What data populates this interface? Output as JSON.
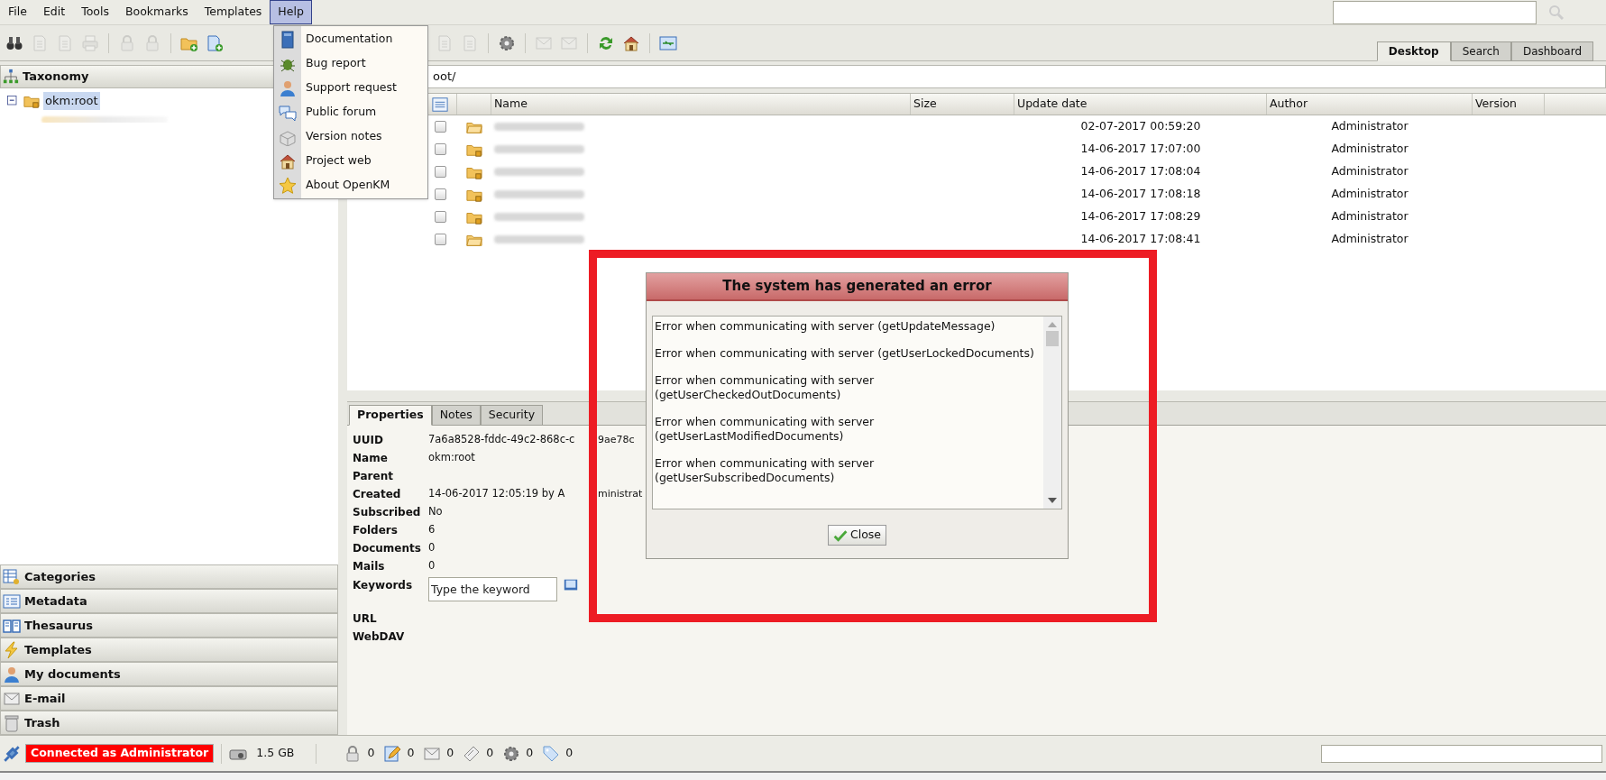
{
  "menu_bar": {
    "items": [
      {
        "label": "File",
        "selected": false
      },
      {
        "label": "Edit",
        "selected": false
      },
      {
        "label": "Tools",
        "selected": false
      },
      {
        "label": "Bookmarks",
        "selected": false
      },
      {
        "label": "Templates",
        "selected": false
      },
      {
        "label": "Help",
        "selected": true
      }
    ]
  },
  "toolbar": {
    "left": [
      {
        "kind": "binoculars",
        "disabled": false
      },
      {
        "kind": "document",
        "disabled": true
      },
      {
        "kind": "document",
        "disabled": true
      },
      {
        "kind": "printer",
        "disabled": true
      },
      {
        "kind": "separator"
      },
      {
        "kind": "lock",
        "disabled": true
      },
      {
        "kind": "lock",
        "disabled": true
      },
      {
        "kind": "separator"
      },
      {
        "kind": "folder_add",
        "disabled": false
      },
      {
        "kind": "document_add",
        "disabled": false
      }
    ],
    "right": [
      {
        "kind": "document",
        "disabled": true
      },
      {
        "kind": "document",
        "disabled": true
      },
      {
        "kind": "separator"
      },
      {
        "kind": "gear",
        "disabled": false
      },
      {
        "kind": "separator"
      },
      {
        "kind": "mail",
        "disabled": true
      },
      {
        "kind": "mail",
        "disabled": true
      },
      {
        "kind": "separator"
      },
      {
        "kind": "refresh",
        "disabled": false
      },
      {
        "kind": "home",
        "disabled": false
      },
      {
        "kind": "separator"
      },
      {
        "kind": "window",
        "disabled": false
      }
    ]
  },
  "tabs": [
    {
      "label": "Desktop",
      "selected": true
    },
    {
      "label": "Search",
      "selected": false
    },
    {
      "label": "Dashboard",
      "selected": false
    }
  ],
  "help_menu": [
    {
      "kind": "book",
      "label": "Documentation"
    },
    {
      "kind": "bug",
      "label": "Bug report"
    },
    {
      "kind": "person",
      "label": "Support request"
    },
    {
      "kind": "chat",
      "label": "Public forum"
    },
    {
      "kind": "blocks",
      "label": "Version notes"
    },
    {
      "kind": "home",
      "label": "Project web"
    },
    {
      "kind": "star",
      "label": "About OpenKM"
    }
  ],
  "navigator": {
    "header": "Taxonomy",
    "tree": {
      "label": "okm:root",
      "expanded": true,
      "selected": true,
      "children": [
        {
          "kind": "blurred_folder"
        }
      ]
    },
    "panels": [
      {
        "kind": "categories",
        "label": "Categories"
      },
      {
        "kind": "metadata",
        "label": "Metadata"
      },
      {
        "kind": "thesaurus",
        "label": "Thesaurus"
      },
      {
        "kind": "templates",
        "label": "Templates"
      },
      {
        "kind": "person",
        "label": "My documents"
      },
      {
        "kind": "mail",
        "label": "E-mail"
      },
      {
        "kind": "trash",
        "label": "Trash"
      }
    ]
  },
  "path": "oot/",
  "file_table": {
    "columns": [
      "Name",
      "Size",
      "Update date",
      "Author",
      "Version"
    ],
    "rows": [
      {
        "kind": "folder",
        "checked": false,
        "update_date": "02-07-2017 00:59:20",
        "author": "Administrator"
      },
      {
        "kind": "shared_folder",
        "checked": false,
        "update_date": "14-06-2017 17:07:00",
        "author": "Administrator"
      },
      {
        "kind": "shared_folder",
        "checked": false,
        "update_date": "14-06-2017 17:08:04",
        "author": "Administrator"
      },
      {
        "kind": "shared_folder",
        "checked": false,
        "update_date": "14-06-2017 17:08:18",
        "author": "Administrator"
      },
      {
        "kind": "shared_folder",
        "checked": false,
        "update_date": "14-06-2017 17:08:29",
        "author": "Administrator"
      },
      {
        "kind": "folder",
        "checked": false,
        "update_date": "14-06-2017 17:08:41",
        "author": "Administrator"
      }
    ]
  },
  "properties": {
    "tabs": [
      {
        "label": "Properties",
        "selected": true
      },
      {
        "label": "Notes",
        "selected": false
      },
      {
        "label": "Security",
        "selected": false
      }
    ],
    "fields": [
      {
        "kind": "text",
        "label": "UUID",
        "value": "7a6a8528-fddc-49c2-868c-c",
        "value_continued": "9ae78c"
      },
      {
        "kind": "text",
        "label": "Name",
        "value": "okm:root"
      },
      {
        "kind": "text",
        "label": "Parent"
      },
      {
        "kind": "text",
        "label": "Created",
        "value": "14-06-2017 12:05:19 by A",
        "value_continued": "ministrat"
      },
      {
        "kind": "text",
        "label": "Subscribed",
        "value": "No"
      },
      {
        "kind": "text",
        "label": "Folders",
        "value": "6"
      },
      {
        "kind": "text",
        "label": "Documents",
        "value": "0"
      },
      {
        "kind": "text",
        "label": "Mails",
        "value": "0"
      },
      {
        "kind": "keywords",
        "label": "Keywords",
        "placeholder": "Type the keyword"
      },
      {
        "kind": "text",
        "label": "URL"
      },
      {
        "kind": "text",
        "label": "WebDAV"
      }
    ]
  },
  "dialog": {
    "title": "The system has generated an error",
    "messages": [
      "Error when communicating with server (getUpdateMessage)",
      "Error when communicating with server (getUserLockedDocuments)",
      "Error when communicating with server (getUserCheckedOutDocuments)",
      "Error when communicating with server (getUserLastModifiedDocuments)",
      "Error when communicating with server (getUserSubscribedDocuments)"
    ],
    "close_button": "Close"
  },
  "status_bar": {
    "connection": "Connected as Administrator",
    "disk": "1.5 GB",
    "counters": [
      {
        "kind": "lock",
        "value": "0"
      },
      {
        "kind": "pencil",
        "value": "0"
      },
      {
        "kind": "mail",
        "value": "0"
      },
      {
        "kind": "ticket",
        "value": "0"
      },
      {
        "kind": "gear",
        "value": "0"
      },
      {
        "kind": "tag",
        "value": "0"
      }
    ]
  }
}
